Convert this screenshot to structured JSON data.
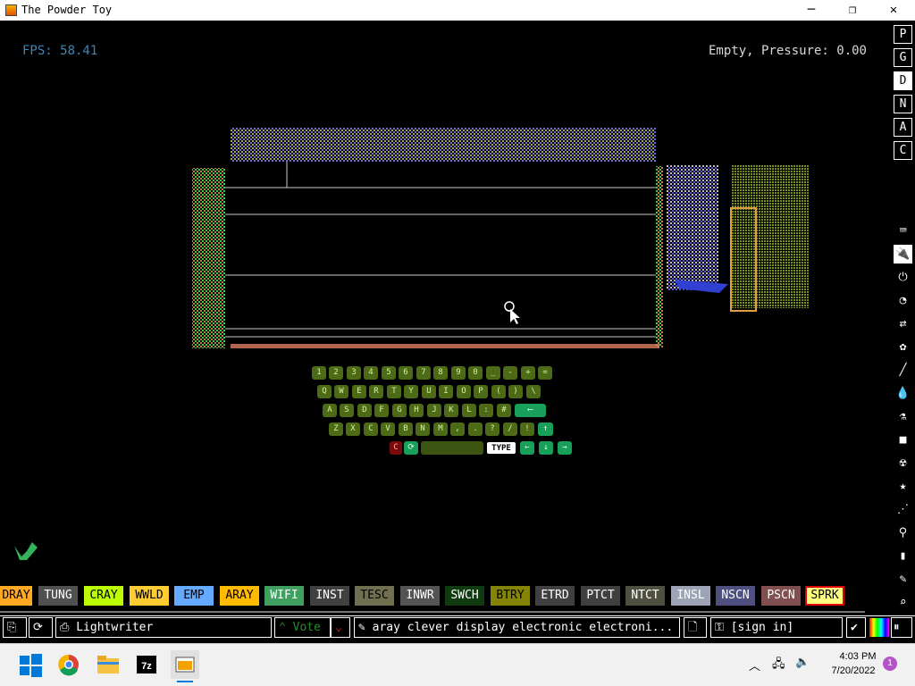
{
  "window": {
    "title": "The Powder Toy",
    "minimize": "─",
    "maximize": "❐",
    "close": "✕"
  },
  "hud": {
    "fps": "FPS: 58.41",
    "status": "Empty, Pressure: 0.00"
  },
  "sidebar": {
    "letters": [
      "P",
      "G",
      "D",
      "N",
      "A",
      "C"
    ],
    "tools": [
      "⌨",
      "🔌",
      "⏻",
      "◔",
      "⇄",
      "✿",
      "╱",
      "💧",
      "⚗",
      "■",
      "☢",
      "★",
      "⋰",
      "⚲",
      "▮",
      "✎",
      "⌕"
    ]
  },
  "keyboard": {
    "row1": [
      "1",
      "2",
      "3",
      "4",
      "5",
      "6",
      "7",
      "8",
      "9",
      "0",
      "_",
      "-",
      "+",
      "="
    ],
    "row2": [
      "Q",
      "W",
      "E",
      "R",
      "T",
      "Y",
      "U",
      "I",
      "O",
      "P",
      "(",
      ")",
      "\\"
    ],
    "row3": [
      "A",
      "S",
      "D",
      "F",
      "G",
      "H",
      "J",
      "K",
      "L",
      ":",
      "#",
      "⟵"
    ],
    "row4": [
      "Z",
      "X",
      "C",
      "V",
      "B",
      "N",
      "M",
      ",",
      ".",
      "?",
      "/",
      "!",
      "↑"
    ],
    "row5": {
      "clear": "C",
      "cycle": "⟳",
      "type": "TYPE",
      "left": "←",
      "down": "↓",
      "right": "→"
    }
  },
  "elements": [
    {
      "label": "DRAY",
      "bg": "#ffaa22",
      "fg": "#000"
    },
    {
      "label": "TUNG",
      "bg": "#505050",
      "fg": "#fff"
    },
    {
      "label": "CRAY",
      "bg": "#bbff00",
      "fg": "#000"
    },
    {
      "label": "WWLD",
      "bg": "#ffcc33",
      "fg": "#000"
    },
    {
      "label": "EMP",
      "bg": "#66aaff",
      "fg": "#000"
    },
    {
      "label": "ARAY",
      "bg": "#ffbb00",
      "fg": "#000"
    },
    {
      "label": "WIFI",
      "bg": "#40a060",
      "fg": "#fff"
    },
    {
      "label": "INST",
      "bg": "#404040",
      "fg": "#fff"
    },
    {
      "label": "TESC",
      "bg": "#707050",
      "fg": "#000"
    },
    {
      "label": "INWR",
      "bg": "#545454",
      "fg": "#fff"
    },
    {
      "label": "SWCH",
      "bg": "#103b11",
      "fg": "#fff"
    },
    {
      "label": "BTRY",
      "bg": "#858505",
      "fg": "#000"
    },
    {
      "label": "ETRD",
      "bg": "#404040",
      "fg": "#fff"
    },
    {
      "label": "PTCT",
      "bg": "#404040",
      "fg": "#fff"
    },
    {
      "label": "NTCT",
      "bg": "#505040",
      "fg": "#fff"
    },
    {
      "label": "INSL",
      "bg": "#9ea3b6",
      "fg": "#fff"
    },
    {
      "label": "NSCN",
      "bg": "#505080",
      "fg": "#fff"
    },
    {
      "label": "PSCN",
      "bg": "#805050",
      "fg": "#fff"
    },
    {
      "label": "SPRK",
      "bg": "#ffff80",
      "fg": "#000"
    }
  ],
  "bottom": {
    "save_name": "Lightwriter",
    "vote": "Vote",
    "tags": "aray clever display electronic electroni...",
    "signin": "[sign in]"
  },
  "taskbar": {
    "time": "4:03 PM",
    "date": "7/20/2022",
    "notif": "1"
  }
}
